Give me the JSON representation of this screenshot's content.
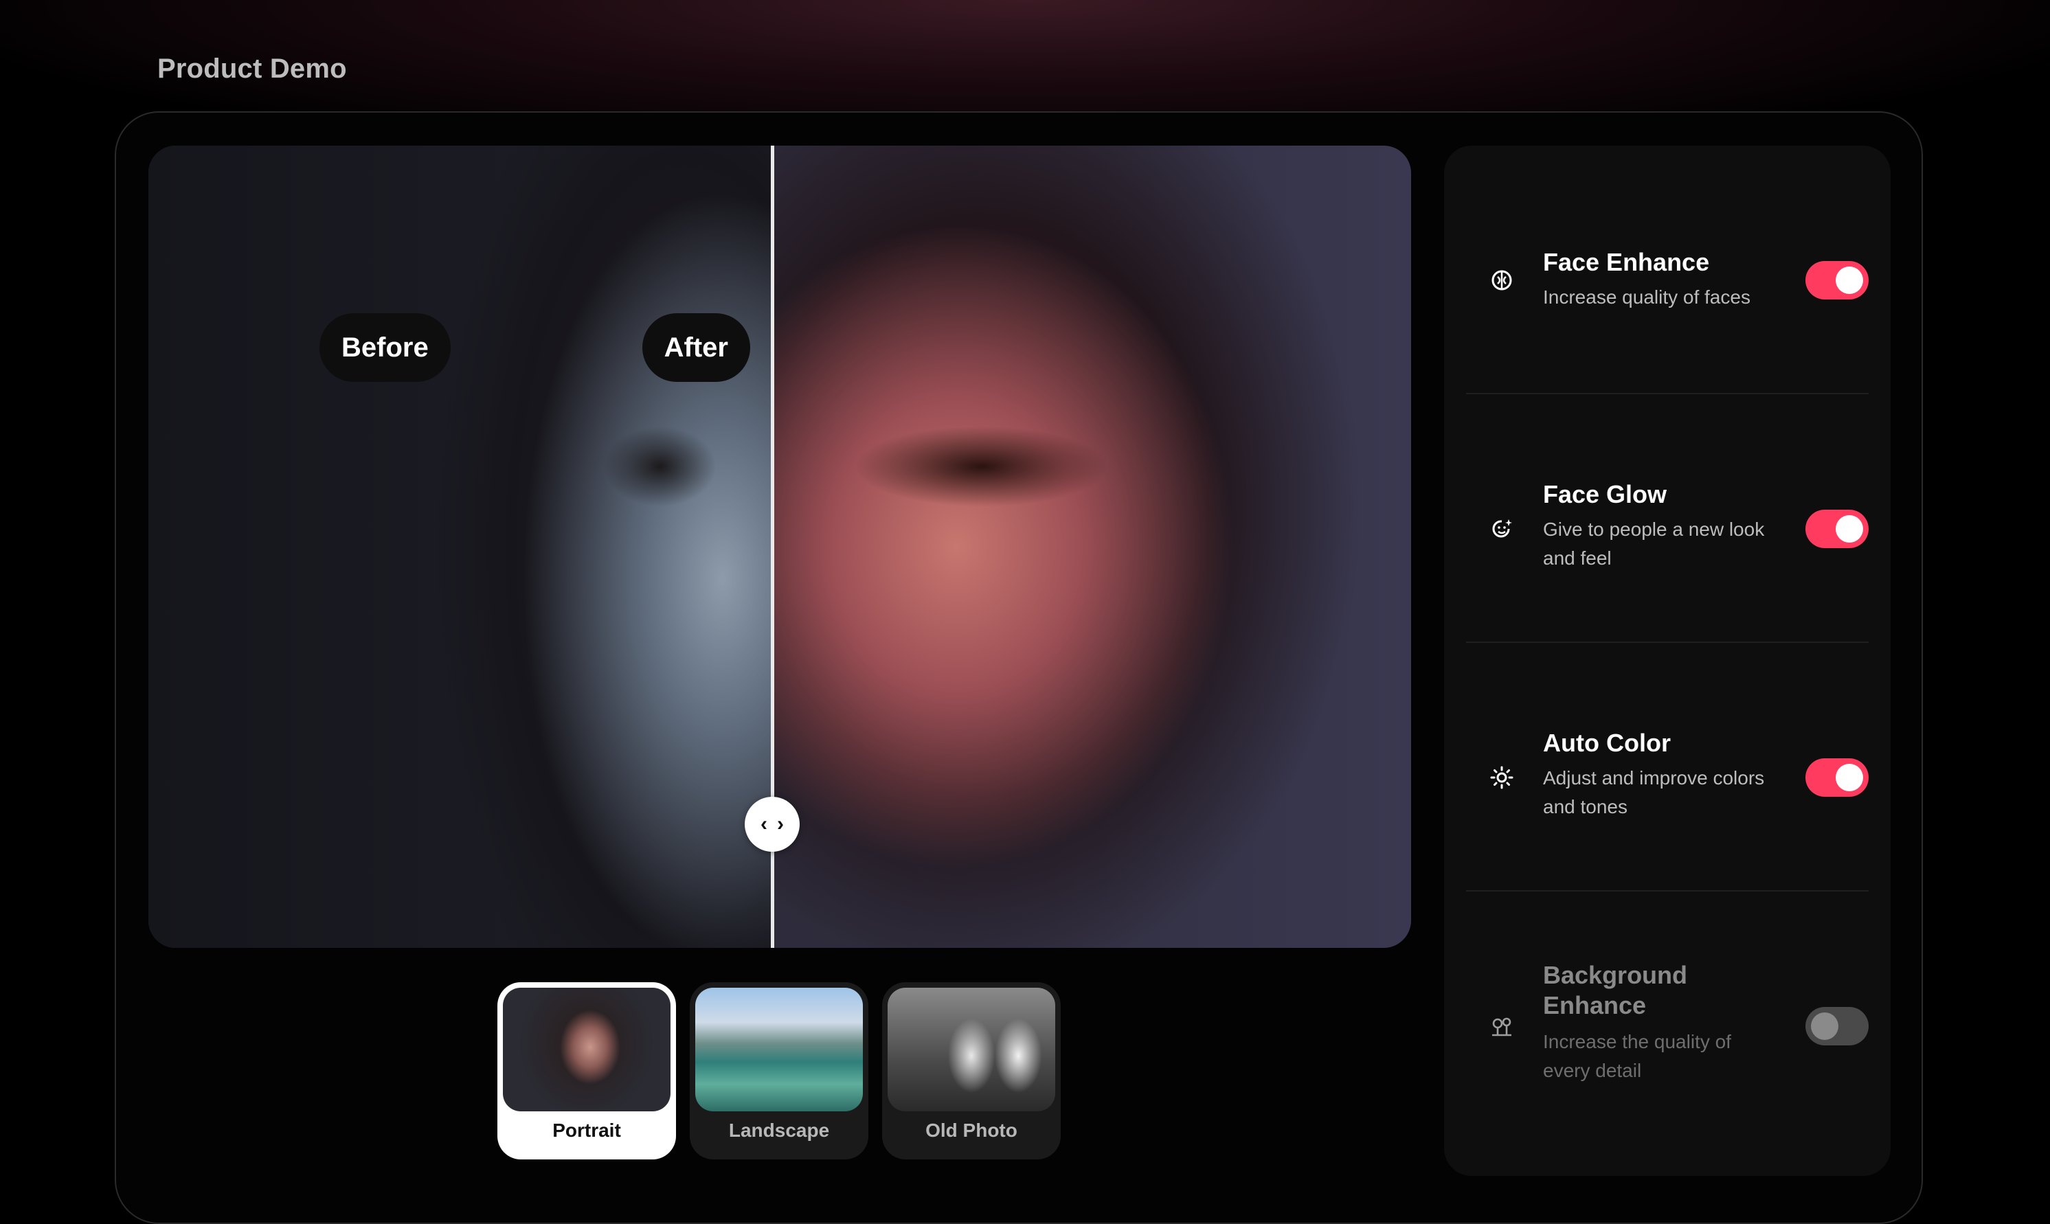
{
  "page": {
    "title": "Product Demo"
  },
  "comparison": {
    "before_label": "Before",
    "after_label": "After",
    "split_fraction": 0.494
  },
  "samples": [
    {
      "label": "Portrait",
      "selected": true
    },
    {
      "label": "Landscape",
      "selected": false
    },
    {
      "label": "Old Photo",
      "selected": false
    }
  ],
  "settings": [
    {
      "icon": "face-enhance-icon",
      "title": "Face Enhance",
      "description": "Increase quality of faces",
      "enabled": true
    },
    {
      "icon": "face-glow-icon",
      "title": "Face Glow",
      "description": "Give to people a new look and feel",
      "enabled": true
    },
    {
      "icon": "sun-icon",
      "title": "Auto Color",
      "description": "Adjust and improve colors and tones",
      "enabled": true
    },
    {
      "icon": "background-enhance-icon",
      "title": "Background Enhance",
      "description": "Increase the quality of every detail",
      "enabled": false
    }
  ],
  "colors": {
    "accent": "#ff3b5f",
    "toggle_off": "#4a4a4a"
  }
}
